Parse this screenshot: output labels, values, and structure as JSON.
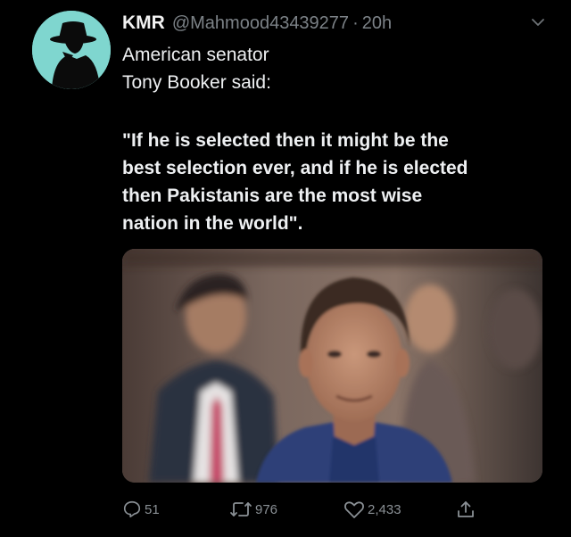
{
  "tweet": {
    "author_name": "KMR",
    "author_handle": "@Mahmood43439277",
    "separator": "·",
    "timestamp": "20h",
    "intro_lines": [
      "American senator",
      "Tony Booker said:"
    ],
    "quote_lines": [
      "\"If he is selected then it might be the",
      "best selection ever, and if he is elected",
      "then Pakistanis are the most wise",
      "nation in the world\"."
    ]
  },
  "actions": {
    "reply_count": "51",
    "retweet_count": "976",
    "like_count": "2,433"
  },
  "icons": {
    "avatar": "detective-silhouette-icon",
    "menu": "chevron-down-icon",
    "reply": "reply-icon",
    "retweet": "retweet-icon",
    "like": "heart-icon",
    "share": "share-icon"
  },
  "colors": {
    "background": "#000000",
    "avatar_bg": "#7fd6cf",
    "muted_text": "#7c8287",
    "body_text": "#eef0f2"
  }
}
